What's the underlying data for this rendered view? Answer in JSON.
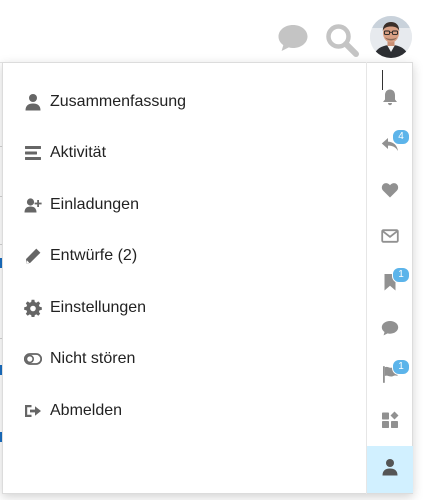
{
  "colors": {
    "menu_icon": "#666666",
    "rail_icon": "#919191",
    "header_icon": "#c4c4c4",
    "badge": "#5cb4ea",
    "active_rail_bg": "#d1f0ff",
    "panel_border": "#dcdcdc",
    "text": "#222222"
  },
  "header": {
    "chat_icon": "chat-bubble",
    "search_icon": "magnifier",
    "avatar": "user-avatar-photo"
  },
  "user_menu": {
    "items": [
      {
        "label": "Zusammenfassung",
        "icon": "user"
      },
      {
        "label": "Aktivität",
        "icon": "stream-bars"
      },
      {
        "label": "Einladungen",
        "icon": "user-plus"
      },
      {
        "label": "Entwürfe (2)",
        "icon": "pencil"
      },
      {
        "label": "Einstellungen",
        "icon": "gear"
      },
      {
        "label": "Nicht stören",
        "icon": "toggle-off"
      },
      {
        "label": "Abmelden",
        "icon": "sign-out"
      }
    ]
  },
  "rail": {
    "buttons": [
      {
        "icon": "bell"
      },
      {
        "icon": "reply",
        "badge": "4"
      },
      {
        "icon": "heart"
      },
      {
        "icon": "envelope"
      },
      {
        "icon": "bookmark",
        "badge": "1"
      },
      {
        "icon": "comment"
      },
      {
        "icon": "flag",
        "badge": "1"
      },
      {
        "icon": "widgets"
      },
      {
        "icon": "user",
        "active": true
      }
    ]
  }
}
